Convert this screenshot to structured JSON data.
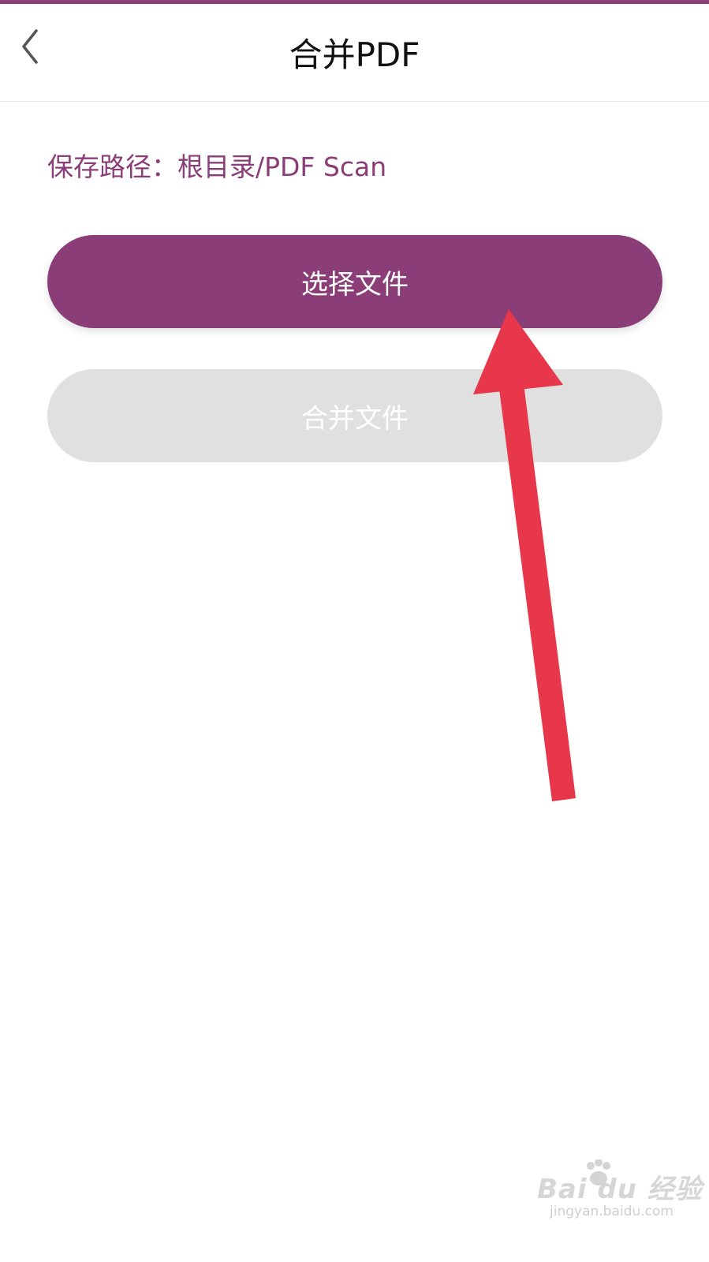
{
  "colors": {
    "accent": "#8a3d77",
    "primary_button": "#8a3d77",
    "disabled_button": "#e0e0e0",
    "annotation_arrow": "#e8364b",
    "title_text": "#111111"
  },
  "header": {
    "back_icon": "chevron-left-icon",
    "title": "合并PDF"
  },
  "main": {
    "save_path": "保存路径：根目录/PDF Scan",
    "select_button_label": "选择文件",
    "merge_button_label": "合并文件",
    "merge_button_disabled": true
  },
  "watermark": {
    "logo_text": "Bai du",
    "logo_suffix": "经验",
    "url": "jingyan.baidu.com"
  }
}
